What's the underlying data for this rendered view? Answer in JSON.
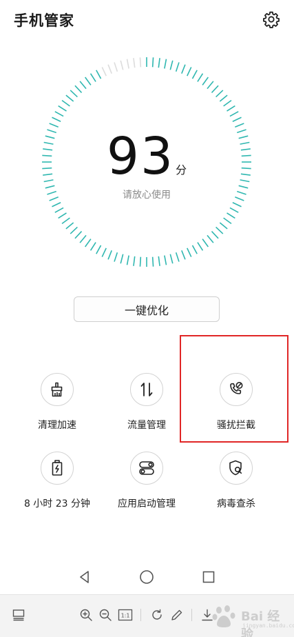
{
  "header": {
    "title": "手机管家",
    "settings_icon": "gear-icon"
  },
  "score": {
    "value": "93",
    "unit": "分",
    "status": "请放心使用",
    "fraction": 0.93,
    "accent_color": "#2fb7b0",
    "track_color": "#dcdcdc"
  },
  "optimize_button": {
    "label": "一键优化"
  },
  "features": [
    {
      "label": "清理加速",
      "icon": "broom-icon"
    },
    {
      "label": "流量管理",
      "icon": "data-transfer-icon"
    },
    {
      "label": "骚扰拦截",
      "icon": "call-block-icon"
    },
    {
      "label": "8 小时 23 分钟",
      "icon": "battery-icon"
    },
    {
      "label": "应用启动管理",
      "icon": "app-launch-icon"
    },
    {
      "label": "病毒查杀",
      "icon": "virus-scan-icon"
    }
  ],
  "highlight_color": "#e02525",
  "navbar": {
    "back_icon": "back-triangle-icon",
    "home_icon": "home-circle-icon",
    "recents_icon": "recents-square-icon"
  },
  "viewer_toolbar": {
    "tools": [
      "layout-icon",
      "zoom-in-icon",
      "zoom-out-icon",
      "actual-size-icon",
      "rotate-icon",
      "edit-pencil-icon",
      "download-icon"
    ],
    "actual_size_label": "1:1"
  },
  "watermark": {
    "text": "Bai 经验",
    "sub": "jingyan.baidu.com"
  }
}
